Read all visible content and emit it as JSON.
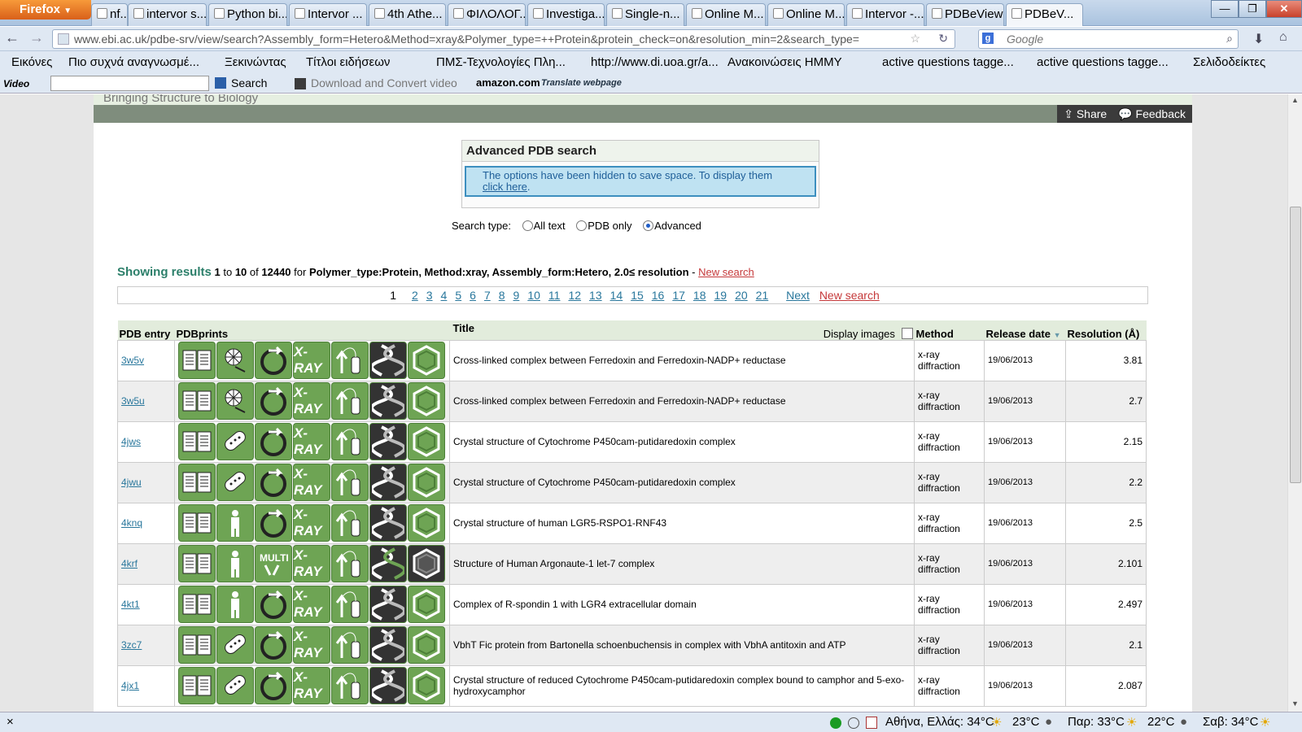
{
  "browser": {
    "menu_button": "Firefox",
    "tabs": [
      {
        "label": "nf..."
      },
      {
        "label": "intervor s..."
      },
      {
        "label": "Python bi..."
      },
      {
        "label": "Intervor ..."
      },
      {
        "label": "4th Athe..."
      },
      {
        "label": "ΦΙΛΟΛΟΓ..."
      },
      {
        "label": "Investiga..."
      },
      {
        "label": "Single-n..."
      },
      {
        "label": "Online M..."
      },
      {
        "label": "Online M..."
      },
      {
        "label": "Intervor -..."
      },
      {
        "label": "PDBeView"
      },
      {
        "label": "PDBeV..."
      }
    ],
    "url": "www.ebi.ac.uk/pdbe-srv/view/search?Assembly_form=Hetero&Method=xray&Polymer_type=++Protein&protein_check=on&resolution_min=2&search_type=",
    "search_placeholder": "Google",
    "bookmarks": [
      "Εικόνες",
      "Πιο συχνά αναγνωσμέ...",
      "Ξεκινώντας",
      "Τίτλοι ειδήσεων",
      "ΠΜΣ-Τεχνολογίες Πλη...",
      "http://www.di.uoa.gr/a...",
      "Ανακοινώσεις ΗΜΜΥ",
      "active questions tagge...",
      "active questions tagge...",
      "Σελιδοδείκτες"
    ],
    "toolbar3": {
      "video": "Video",
      "search": "Search",
      "download": "Download and Convert video",
      "amazon": "amazon.com",
      "translate": "Translate webpage"
    },
    "status": {
      "close": "×",
      "weather": "Αθήνα, Ελλάς: 34°C",
      "t1": "23°C",
      "t2": "Παρ: 33°C",
      "t3": "22°C",
      "t4": "Σαβ: 34°C"
    }
  },
  "site": {
    "tagline": "Bringing Structure to Biology",
    "share": "Share",
    "feedback": "Feedback"
  },
  "advanced": {
    "title": "Advanced PDB search",
    "note": "The options have been hidden to save space. To display them",
    "link": "click here",
    "period": "."
  },
  "search_type": {
    "label": "Search type:",
    "options": [
      "All text",
      "PDB only",
      "Advanced"
    ],
    "selected": "Advanced"
  },
  "summary": {
    "lead": "Showing results",
    "from": "1",
    "to_word": "to",
    "to": "10",
    "of_word": "of",
    "total": "12440",
    "for_word": "for",
    "query": "Polymer_type:Protein, Method:xray, Assembly_form:Hetero, 2.0≤ resolution",
    "dash": "-",
    "new_search": "New search"
  },
  "pager": {
    "current": "1",
    "pages": [
      "2",
      "3",
      "4",
      "5",
      "6",
      "7",
      "8",
      "9",
      "10",
      "11",
      "12",
      "13",
      "14",
      "15",
      "16",
      "17",
      "18",
      "19",
      "20",
      "21"
    ],
    "next": "Next",
    "new_search": "New search"
  },
  "table": {
    "headers": {
      "entry": "PDB entry",
      "prints": "PDBprints",
      "title": "Title",
      "display_images": "Display images",
      "method": "Method",
      "release": "Release date",
      "resolution": "Resolution (Å)"
    },
    "rows": [
      {
        "id": "3w5v",
        "title": "Cross-linked complex between Ferredoxin and Ferredoxin-NADP+ reductase",
        "method": "x-ray diffraction",
        "date": "19/06/2013",
        "res": "3.81"
      },
      {
        "id": "3w5u",
        "title": "Cross-linked complex between Ferredoxin and Ferredoxin-NADP+ reductase",
        "method": "x-ray diffraction",
        "date": "19/06/2013",
        "res": "2.7"
      },
      {
        "id": "4jws",
        "title": "Crystal structure of Cytochrome P450cam-putidaredoxin complex",
        "method": "x-ray diffraction",
        "date": "19/06/2013",
        "res": "2.15"
      },
      {
        "id": "4jwu",
        "title": "Crystal structure of Cytochrome P450cam-putidaredoxin complex",
        "method": "x-ray diffraction",
        "date": "19/06/2013",
        "res": "2.2"
      },
      {
        "id": "4knq",
        "title": "Crystal structure of human LGR5-RSPO1-RNF43",
        "method": "x-ray diffraction",
        "date": "19/06/2013",
        "res": "2.5"
      },
      {
        "id": "4krf",
        "title": "Structure of Human Argonaute-1 let-7 complex",
        "method": "x-ray diffraction",
        "date": "19/06/2013",
        "res": "2.101"
      },
      {
        "id": "4kt1",
        "title": "Complex of R-spondin 1 with LGR4 extracellular domain",
        "method": "x-ray diffraction",
        "date": "19/06/2013",
        "res": "2.497"
      },
      {
        "id": "3zc7",
        "title": "VbhT Fic protein from Bartonella schoenbuchensis in complex with VbhA antitoxin and ATP",
        "method": "x-ray diffraction",
        "date": "19/06/2013",
        "res": "2.1"
      },
      {
        "id": "4jx1",
        "title": "Crystal structure of reduced Cytochrome P450cam-putidaredoxin complex bound to camphor and 5-exo-hydroxycamphor",
        "method": "x-ray diffraction",
        "date": "19/06/2013",
        "res": "2.087"
      }
    ],
    "print_icons": [
      "citation-icon",
      "organism-icon",
      "assembly-icon",
      "xray-icon",
      "protein-icon",
      "dna-icon",
      "ligand-icon"
    ],
    "xray_label": "X-RAY",
    "multi_label": "MULTI"
  },
  "colors": {
    "accent_green": "#2c7f6a",
    "icon_green": "#6ea454",
    "link_blue": "#29779c",
    "link_red": "#c5393a"
  }
}
